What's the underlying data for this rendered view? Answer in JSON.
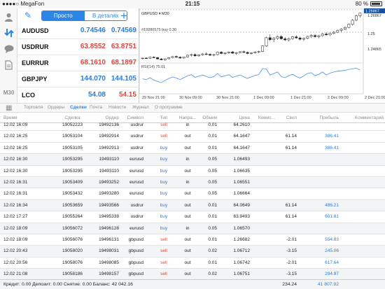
{
  "status_bar": {
    "carrier": "●●●●○ MegaFon",
    "time": "21:15",
    "battery": "80 %"
  },
  "sidebar": {
    "timeframe": "M30",
    "icons": [
      "user-icon",
      "quotes-arrows-icon",
      "chat-icon",
      "document-icon",
      "calendar-icon"
    ]
  },
  "quotes": {
    "mode_simple": "Просто",
    "mode_detailed": "В деталях",
    "rows": [
      {
        "symbol": "AUDUSD",
        "bid": "0.74546",
        "ask": "0.74569",
        "color": "blue"
      },
      {
        "symbol": "USDRUR",
        "bid": "63.8552",
        "ask": "63.8751",
        "color": "red"
      },
      {
        "symbol": "EURRUR",
        "bid": "68.1610",
        "ask": "68.1897",
        "color": "red"
      },
      {
        "symbol": "GBPJPY",
        "bid": "144.070",
        "ask": "144.105",
        "color": "blue"
      },
      {
        "symbol": "LCO",
        "bid": "54.08",
        "ask": "54.15",
        "color": "mixed"
      }
    ]
  },
  "chart": {
    "symbol_label": "GBPUSD ▾ M30",
    "line_label": "#19280575 buy 0.30",
    "indicator_label": "RSI(14) 75.01",
    "price_levels": [
      "1.26867",
      "1.25",
      "1.24865"
    ],
    "current_price": "1.26867",
    "x_labels": [
      "29 Nov 21:00",
      "30 Nov 09:00",
      "30 Nov 21:00",
      "1 Dec 09:00",
      "1 Dec 21:00",
      "2 Dec 09:00",
      "2 Dec 21:00"
    ],
    "candles": [
      [
        1.248,
        1.2484,
        1.2476,
        1.2482
      ],
      [
        1.2482,
        1.2486,
        1.2479,
        1.2481
      ],
      [
        1.2481,
        1.2488,
        1.2478,
        1.2486
      ],
      [
        1.2486,
        1.249,
        1.2482,
        1.2484
      ],
      [
        1.2484,
        1.2487,
        1.2476,
        1.2478
      ],
      [
        1.2478,
        1.2482,
        1.2472,
        1.2474
      ],
      [
        1.2474,
        1.248,
        1.247,
        1.2479
      ],
      [
        1.2479,
        1.2486,
        1.2476,
        1.2484
      ],
      [
        1.2484,
        1.2492,
        1.2481,
        1.2489
      ],
      [
        1.2489,
        1.2494,
        1.2483,
        1.2486
      ],
      [
        1.2486,
        1.249,
        1.248,
        1.2482
      ],
      [
        1.2482,
        1.2488,
        1.2479,
        1.2487
      ],
      [
        1.2487,
        1.2498,
        1.2484,
        1.2495
      ],
      [
        1.2495,
        1.2502,
        1.249,
        1.2498
      ],
      [
        1.2498,
        1.2503,
        1.2489,
        1.2492
      ],
      [
        1.2492,
        1.25,
        1.2488,
        1.2497
      ],
      [
        1.2497,
        1.2505,
        1.2493,
        1.2501
      ],
      [
        1.2501,
        1.2508,
        1.2496,
        1.2499
      ],
      [
        1.2499,
        1.2504,
        1.2492,
        1.2495
      ],
      [
        1.2495,
        1.2501,
        1.249,
        1.2498
      ],
      [
        1.2498,
        1.2512,
        1.2495,
        1.2509
      ],
      [
        1.2509,
        1.2514,
        1.25,
        1.2503
      ],
      [
        1.2503,
        1.2508,
        1.2497,
        1.2506
      ],
      [
        1.2506,
        1.2512,
        1.2502,
        1.251
      ],
      [
        1.251,
        1.2514,
        1.2502,
        1.2504
      ],
      [
        1.2504,
        1.2509,
        1.2498,
        1.2507
      ],
      [
        1.2507,
        1.2513,
        1.2503,
        1.2511
      ],
      [
        1.2511,
        1.2516,
        1.2505,
        1.2508
      ],
      [
        1.2508,
        1.2512,
        1.25,
        1.2503
      ],
      [
        1.2503,
        1.2508,
        1.2498,
        1.2506
      ],
      [
        1.2506,
        1.2513,
        1.2503,
        1.251
      ],
      [
        1.251,
        1.2515,
        1.2505,
        1.2512
      ],
      [
        1.2512,
        1.254,
        1.251,
        1.2537
      ],
      [
        1.2537,
        1.258,
        1.2533,
        1.2575
      ],
      [
        1.2575,
        1.259,
        1.256,
        1.2566
      ],
      [
        1.2566,
        1.2578,
        1.2555,
        1.2572
      ],
      [
        1.2572,
        1.2585,
        1.2565,
        1.258
      ],
      [
        1.258,
        1.2588,
        1.2566,
        1.257
      ],
      [
        1.257,
        1.2578,
        1.256,
        1.2565
      ],
      [
        1.2565,
        1.2575,
        1.2558,
        1.2571
      ],
      [
        1.2571,
        1.2583,
        1.2566,
        1.2579
      ],
      [
        1.2579,
        1.2586,
        1.257,
        1.2574
      ],
      [
        1.2574,
        1.258,
        1.2563,
        1.2568
      ],
      [
        1.2568,
        1.2576,
        1.256,
        1.2572
      ],
      [
        1.2572,
        1.2584,
        1.2568,
        1.2581
      ],
      [
        1.2581,
        1.259,
        1.2574,
        1.2585
      ],
      [
        1.2585,
        1.2592,
        1.2576,
        1.258
      ],
      [
        1.258,
        1.2588,
        1.2573,
        1.2584
      ],
      [
        1.2584,
        1.2596,
        1.258,
        1.2592
      ],
      [
        1.2592,
        1.26,
        1.2584,
        1.2588
      ],
      [
        1.2588,
        1.2598,
        1.2583,
        1.2595
      ],
      [
        1.2595,
        1.2605,
        1.259,
        1.26
      ],
      [
        1.26,
        1.2612,
        1.2596,
        1.2608
      ],
      [
        1.2608,
        1.2618,
        1.26,
        1.2614
      ],
      [
        1.2614,
        1.2626,
        1.2609,
        1.2622
      ],
      [
        1.2622,
        1.264,
        1.2618,
        1.2636
      ],
      [
        1.2636,
        1.266,
        1.263,
        1.2655
      ],
      [
        1.2655,
        1.268,
        1.265,
        1.2675
      ],
      [
        1.2675,
        1.269,
        1.2668,
        1.2687
      ]
    ],
    "rsi": [
      52,
      50,
      55,
      49,
      45,
      42,
      48,
      53,
      57,
      54,
      50,
      55,
      60,
      63,
      56,
      59,
      62,
      58,
      55,
      58,
      66,
      57,
      60,
      63,
      56,
      59,
      62,
      57,
      53,
      57,
      61,
      63,
      79,
      78,
      62,
      66,
      70,
      58,
      55,
      60,
      64,
      58,
      54,
      60,
      66,
      68,
      60,
      64,
      70,
      62,
      67,
      70,
      72,
      73,
      74,
      77,
      78,
      80,
      75
    ]
  },
  "tabs": {
    "items": [
      "Торговля",
      "Ордеры",
      "Сделки",
      "Почта",
      "Новости",
      "Журнал",
      "О программе"
    ],
    "active": "Сделки"
  },
  "table": {
    "headers": [
      "Время",
      "Сделка",
      "Ордер",
      "Символ",
      "Тип",
      "Напра...",
      "Объем",
      "Цена",
      "Комис...",
      "Своп",
      "Прибыль",
      "Комментарий"
    ],
    "rows": [
      {
        "time": "12.02 16:09",
        "deal": "19052223",
        "order": "19492136",
        "symbol": "usdrur",
        "type": "sell",
        "dir": "in",
        "vol": "0.01",
        "price": "64.2610",
        "comm": "",
        "swap": "",
        "profit": "",
        "shade": false
      },
      {
        "time": "12.02 16:25",
        "deal": "19053104",
        "order": "19492914",
        "symbol": "usdrur",
        "type": "sell",
        "dir": "out",
        "vol": "0.01",
        "price": "64.1647",
        "comm": "",
        "swap": "61.14",
        "profit": "386.41",
        "shade": false
      },
      {
        "time": "12.02 16:25",
        "deal": "19053105",
        "order": "19492913",
        "symbol": "usdrur",
        "type": "buy",
        "dir": "out",
        "vol": "0.01",
        "price": "64.1647",
        "comm": "",
        "swap": "61.14",
        "profit": "386.41",
        "shade": false
      },
      {
        "time": "12.02 16:30",
        "deal": "19053295",
        "order": "19493110",
        "symbol": "eurusd",
        "type": "buy",
        "dir": "in",
        "vol": "0.05",
        "price": "1.06493",
        "comm": "",
        "swap": "",
        "profit": "",
        "shade": true
      },
      {
        "time": "12.02 16:30",
        "deal": "19053295",
        "order": "19493110",
        "symbol": "eurusd",
        "type": "buy",
        "dir": "out",
        "vol": "0.05",
        "price": "1.06635",
        "comm": "",
        "swap": "",
        "profit": "",
        "shade": false
      },
      {
        "time": "12.02 16:31",
        "deal": "19053409",
        "order": "19493252",
        "symbol": "eurusd",
        "type": "buy",
        "dir": "in",
        "vol": "0.05",
        "price": "1.06551",
        "comm": "",
        "swap": "",
        "profit": "",
        "shade": true
      },
      {
        "time": "12.02 16:31",
        "deal": "19053432",
        "order": "19493280",
        "symbol": "eurusd",
        "type": "buy",
        "dir": "out",
        "vol": "0.05",
        "price": "1.06664",
        "comm": "",
        "swap": "",
        "profit": "",
        "shade": false
      },
      {
        "time": "12.02 16:34",
        "deal": "19053659",
        "order": "19493566",
        "symbol": "usdrur",
        "type": "buy",
        "dir": "out",
        "vol": "0.01",
        "price": "64.0649",
        "comm": "",
        "swap": "61.14",
        "profit": "486.21",
        "shade": true
      },
      {
        "time": "12.02 17:27",
        "deal": "19055264",
        "order": "19495338",
        "symbol": "usdrur",
        "type": "buy",
        "dir": "out",
        "vol": "0.01",
        "price": "63.9493",
        "comm": "",
        "swap": "61.14",
        "profit": "601.81",
        "shade": false
      },
      {
        "time": "12.02 18:09",
        "deal": "19056072",
        "order": "19496128",
        "symbol": "eurusd",
        "type": "buy",
        "dir": "in",
        "vol": "0.05",
        "price": "1.06570",
        "comm": "",
        "swap": "",
        "profit": "",
        "shade": true
      },
      {
        "time": "12.02 18:09",
        "deal": "19056076",
        "order": "19496131",
        "symbol": "gbpusd",
        "type": "sell",
        "dir": "out",
        "vol": "0.01",
        "price": "1.26682",
        "comm": "",
        "swap": "-2.01",
        "profit": "554.83",
        "shade": false
      },
      {
        "time": "12.02 20:43",
        "deal": "19058020",
        "order": "19498031",
        "symbol": "gbpusd",
        "type": "sell",
        "dir": "out",
        "vol": "0.02",
        "price": "1.06712",
        "comm": "",
        "swap": "-3.15",
        "profit": "245.06",
        "shade": true
      },
      {
        "time": "12.02 20:56",
        "deal": "19058076",
        "order": "19498085",
        "symbol": "gbpusd",
        "type": "sell",
        "dir": "out",
        "vol": "0.01",
        "price": "1.06742",
        "comm": "",
        "swap": "-2.01",
        "profit": "617.64",
        "shade": false
      },
      {
        "time": "12.02 21:08",
        "deal": "19058186",
        "order": "19498157",
        "symbol": "gbpusd",
        "type": "sell",
        "dir": "out",
        "vol": "0.02",
        "price": "1.06751",
        "comm": "",
        "swap": "-3.15",
        "profit": "294.97",
        "shade": true
      }
    ]
  },
  "footer": {
    "summary": "Кредит: 0.00 Депозит: 0.00 Снятие: 0.00 Баланс: 42 042.16",
    "swap_total": "234.24",
    "profit_total": "41 807.92"
  },
  "colors": {
    "accent": "#2d86e6",
    "buy": "#2b7be0",
    "sell": "#e0443c",
    "rsi_line": "#4a90e2"
  }
}
